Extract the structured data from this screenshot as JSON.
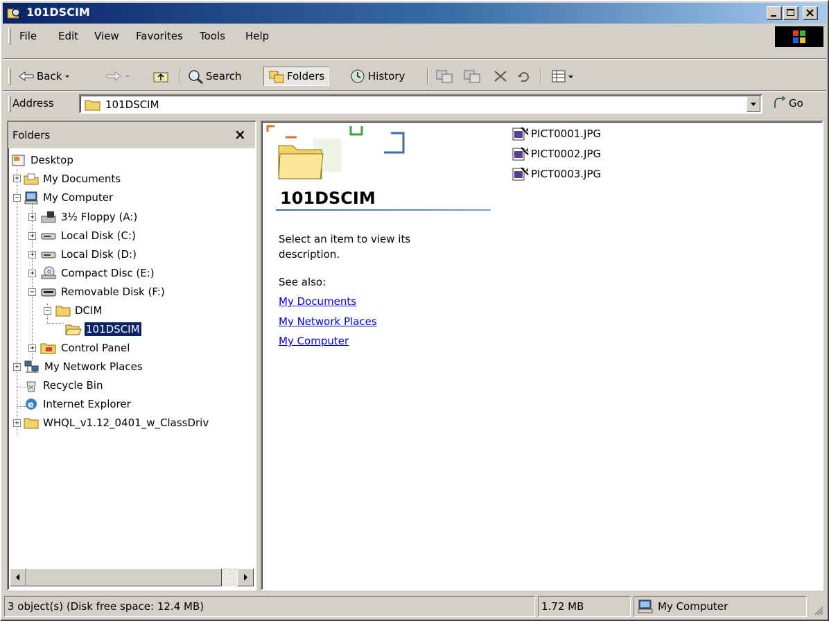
{
  "window": {
    "title": "101DSCIM"
  },
  "menu": {
    "items": [
      {
        "label": "File"
      },
      {
        "label": "Edit"
      },
      {
        "label": "View"
      },
      {
        "label": "Favorites"
      },
      {
        "label": "Tools"
      },
      {
        "label": "Help"
      }
    ]
  },
  "toolbar": {
    "back": "Back",
    "search": "Search",
    "folders": "Folders",
    "history": "History"
  },
  "address": {
    "label": "Address",
    "value": "101DSCIM",
    "go": "Go"
  },
  "folders_pane": {
    "title": "Folders",
    "close": "×",
    "tree": [
      {
        "label": "Desktop"
      },
      {
        "label": "My Documents"
      },
      {
        "label": "My Computer"
      },
      {
        "label": "3½ Floppy (A:)"
      },
      {
        "label": "Local Disk (C:)"
      },
      {
        "label": "Local Disk (D:)"
      },
      {
        "label": "Compact Disc (E:)"
      },
      {
        "label": "Removable Disk (F:)"
      },
      {
        "label": "DCIM"
      },
      {
        "label": "101DSCIM",
        "selected": true
      },
      {
        "label": "Control Panel"
      },
      {
        "label": "My Network Places"
      },
      {
        "label": "Recycle Bin"
      },
      {
        "label": "Internet Explorer"
      },
      {
        "label": "WHQL_v1.12_0401_w_ClassDriv"
      }
    ]
  },
  "webview": {
    "title": "101DSCIM",
    "description_line1": "Select an item to view its",
    "description_line2": "description.",
    "see_also": "See also:",
    "links": [
      "My Documents",
      "My Network Places",
      "My Computer"
    ]
  },
  "files": [
    {
      "name": "PICT0001.JPG"
    },
    {
      "name": "PICT0002.JPG"
    },
    {
      "name": "PICT0003.JPG"
    }
  ],
  "status": {
    "objects": "3 object(s) (Disk free space: 12.4 MB)",
    "size": "1.72 MB",
    "zone": "My Computer"
  },
  "colors": {
    "titlebar_start": "#0a246a",
    "titlebar_end": "#a6caf0",
    "selection": "#0a246a",
    "chrome": "#d4d0c8",
    "link": "#0000ee"
  }
}
